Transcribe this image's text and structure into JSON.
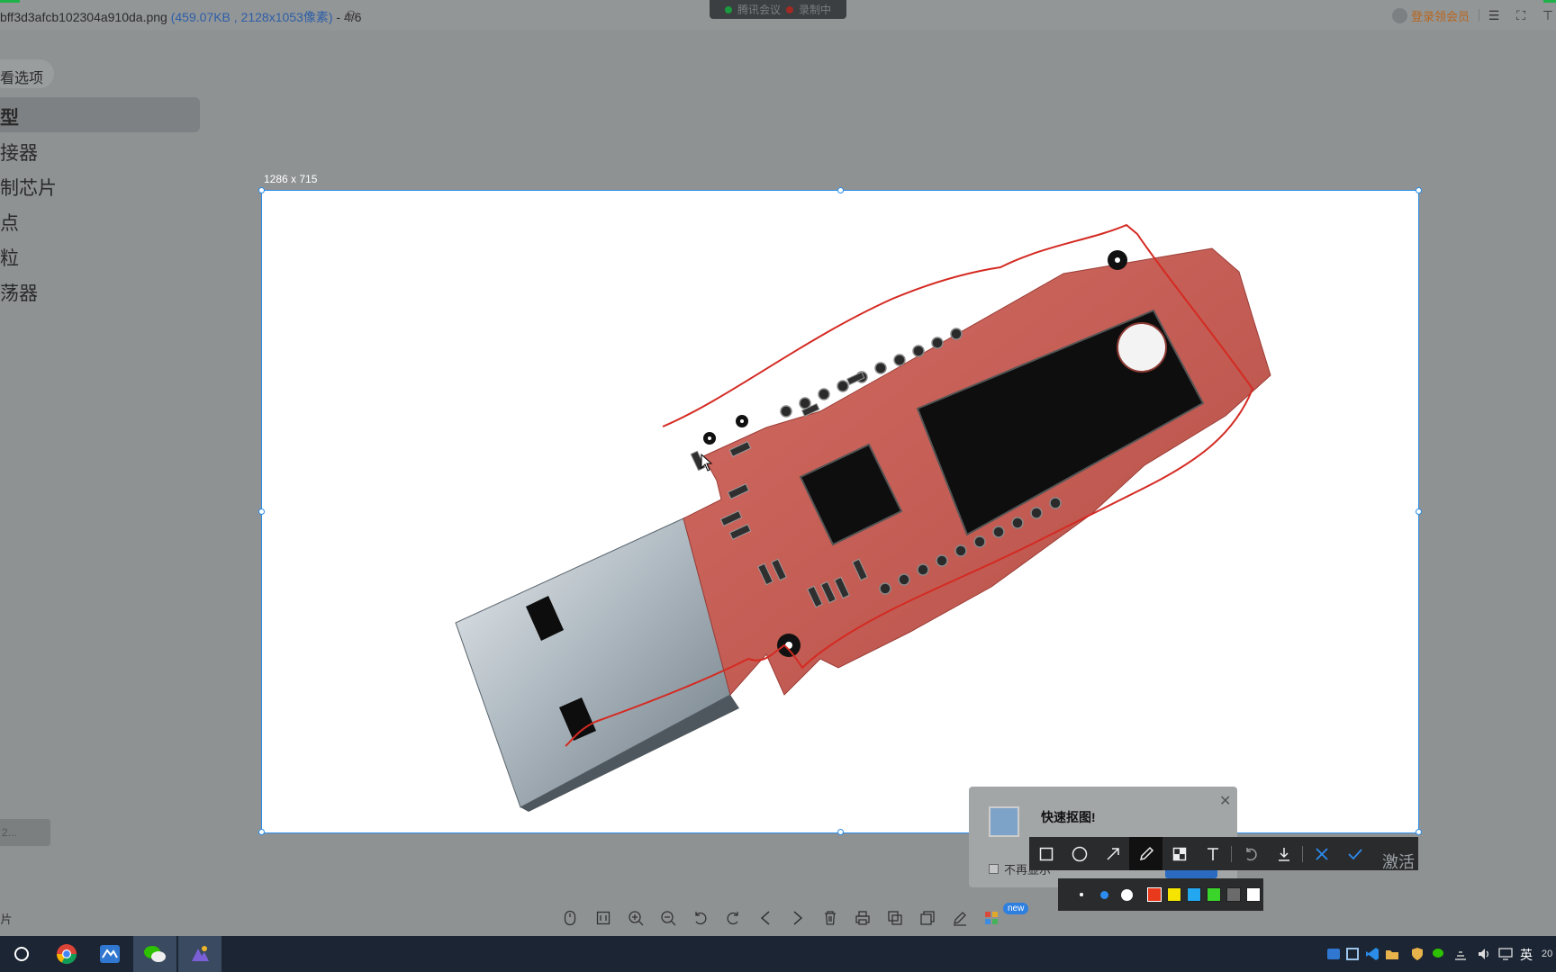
{
  "titlebar": {
    "filename": "bff3d3afcb102304a910da.png",
    "fileinfo": "(459.07KB , 2128x1053像素)",
    "position": "- 4/6"
  },
  "meeting": {
    "app": "腾讯会议",
    "status": "录制中"
  },
  "account": {
    "login_label": "登录领会员"
  },
  "sidebar": {
    "filter_label": "看选项",
    "items": [
      {
        "label": "型"
      },
      {
        "label": "接器"
      },
      {
        "label": "制芯片"
      },
      {
        "label": "点"
      },
      {
        "label": "粒"
      },
      {
        "label": "荡器"
      }
    ],
    "bottom_label": "2..."
  },
  "selection": {
    "size_label": "1286 x 715"
  },
  "popup": {
    "title": "快速抠图!",
    "checkbox_label": "不再显示"
  },
  "screenshot_tools": {
    "items": [
      "rectangle-icon",
      "ellipse-icon",
      "arrow-icon",
      "pencil-icon",
      "mosaic-icon",
      "text-icon",
      "undo-icon",
      "download-icon",
      "cancel-icon",
      "confirm-icon"
    ],
    "active": "pencil-icon"
  },
  "palette": {
    "sizes": [
      "small",
      "medium",
      "large"
    ],
    "active_size": "medium",
    "colors": [
      "#e8391d",
      "#f5e400",
      "#22a7f0",
      "#3ad42a",
      "#6b6b6b",
      "#ffffff"
    ]
  },
  "watermark": {
    "text": "激活"
  },
  "viewer_toolbar": {
    "items": [
      "mouse-icon",
      "fit-icon",
      "zoom-in-icon",
      "zoom-out-icon",
      "rotate-left-icon",
      "rotate-right-icon",
      "prev-icon",
      "next-icon",
      "delete-icon",
      "print-icon",
      "compare-icon",
      "copy-icon",
      "edit-icon",
      "apps-icon"
    ],
    "new_badge": "new",
    "left_label": "片"
  },
  "taskbar": {
    "apps": [
      "cortana-icon",
      "chrome-icon",
      "app-blue-icon",
      "wechat-icon",
      "app-gallery-icon"
    ],
    "ime": "英",
    "clock": "20"
  },
  "colors": {
    "accent": "#2b8de8",
    "annotation": "#d42a22",
    "pcb": "#c85e55"
  }
}
